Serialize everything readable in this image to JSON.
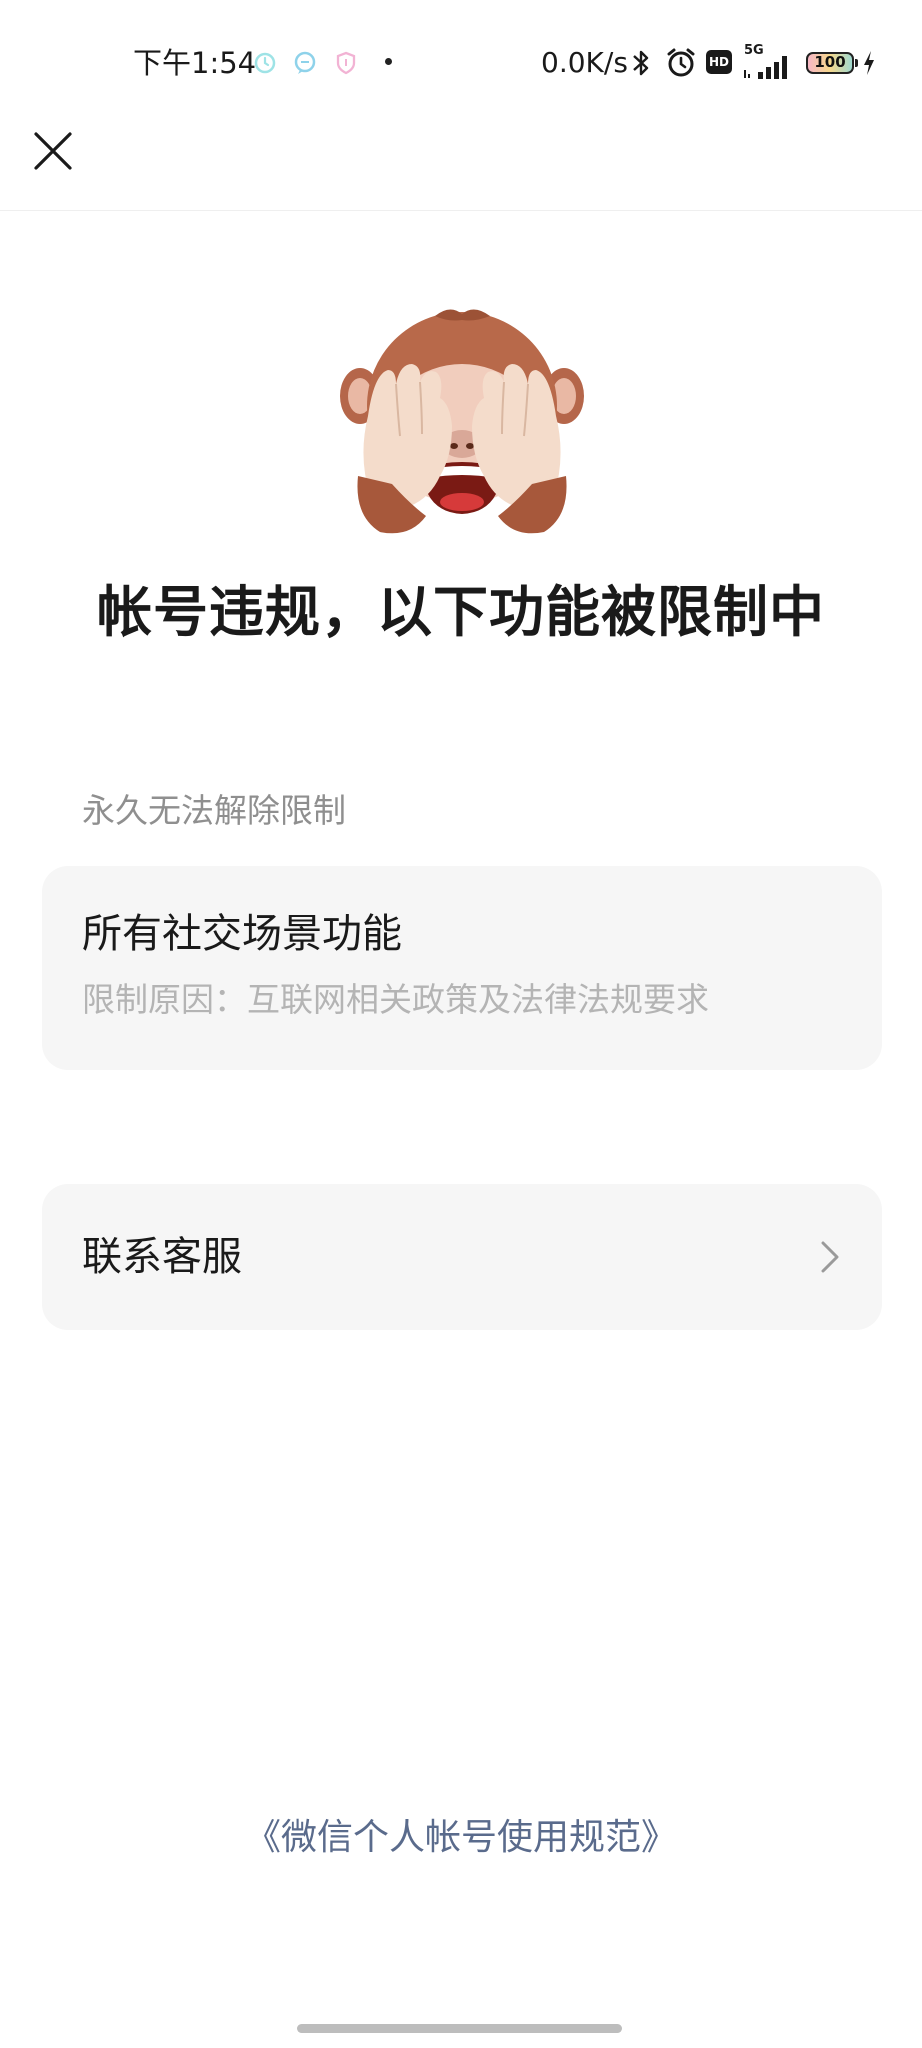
{
  "status_bar": {
    "time": "下午1:54",
    "net_speed": "0.0K/s",
    "signal_label": "5G",
    "hd_label": "HD",
    "battery_level": "100"
  },
  "nav": {
    "close_icon": "close-icon"
  },
  "hero": {
    "title": "帐号违规，以下功能被限制中"
  },
  "restriction": {
    "section_label": "永久无法解除限制",
    "title": "所有社交场景功能",
    "reason": "限制原因：互联网相关政策及法律法规要求"
  },
  "service": {
    "label": "联系客服"
  },
  "footer": {
    "policy_link": "《微信个人帐号使用规范》"
  },
  "colors": {
    "card_bg": "#f6f6f6",
    "link": "#5a6b8c",
    "muted_text": "#8f8f8f",
    "faint_text": "#b4b4b4"
  }
}
